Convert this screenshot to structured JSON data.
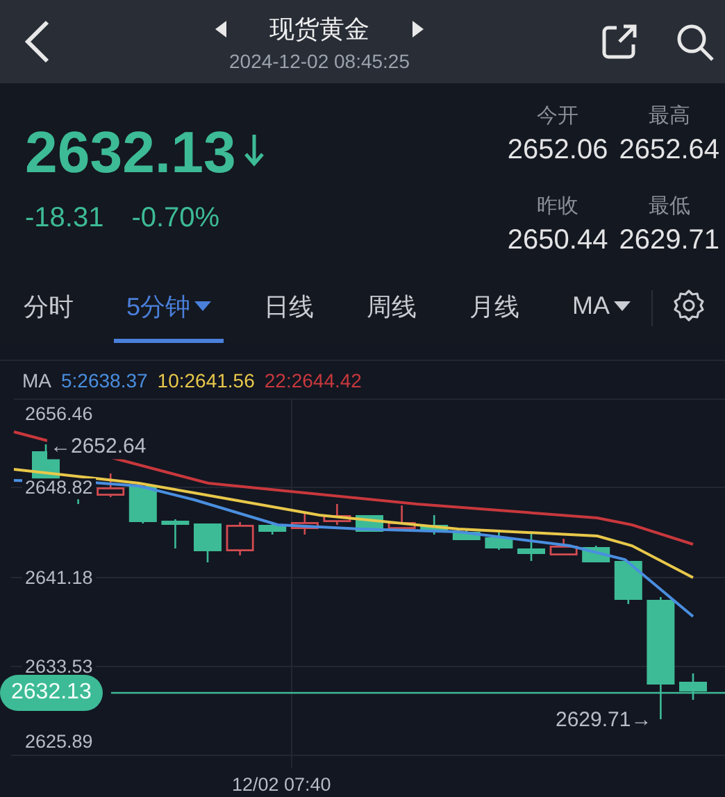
{
  "header": {
    "title": "现货黄金",
    "timestamp": "2024-12-02 08:45:25"
  },
  "quote": {
    "price": "2632.13",
    "falling": true,
    "change": "-18.31",
    "change_percent": "-0.70%",
    "stats": [
      {
        "label": "今开",
        "value": "2652.06"
      },
      {
        "label": "最高",
        "value": "2652.64"
      },
      {
        "label": "昨收",
        "value": "2650.44"
      },
      {
        "label": "最低",
        "value": "2629.71"
      }
    ]
  },
  "tabs": [
    {
      "label": "分时",
      "selected": false,
      "dropdown": false
    },
    {
      "label": "5分钟",
      "selected": true,
      "dropdown": true
    },
    {
      "label": "日线",
      "selected": false,
      "dropdown": false
    },
    {
      "label": "周线",
      "selected": false,
      "dropdown": false
    },
    {
      "label": "月线",
      "selected": false,
      "dropdown": false
    },
    {
      "label": "MA",
      "selected": false,
      "dropdown": true
    }
  ],
  "chart": {
    "ma_prefix": "MA",
    "ma_lines": [
      {
        "label": "5:2638.37",
        "color": "#4a8fe0"
      },
      {
        "label": "10:2641.56",
        "color": "#e8c84a"
      },
      {
        "label": "22:2644.42",
        "color": "#c8383c"
      }
    ],
    "y_labels": [
      "2656.46",
      "2648.82",
      "2641.18",
      "2633.53",
      "2625.89"
    ],
    "x_label": "12/02 07:40",
    "high_marker": "←2652.64",
    "low_marker": "2629.71→",
    "current_price": "2632.13"
  }
}
